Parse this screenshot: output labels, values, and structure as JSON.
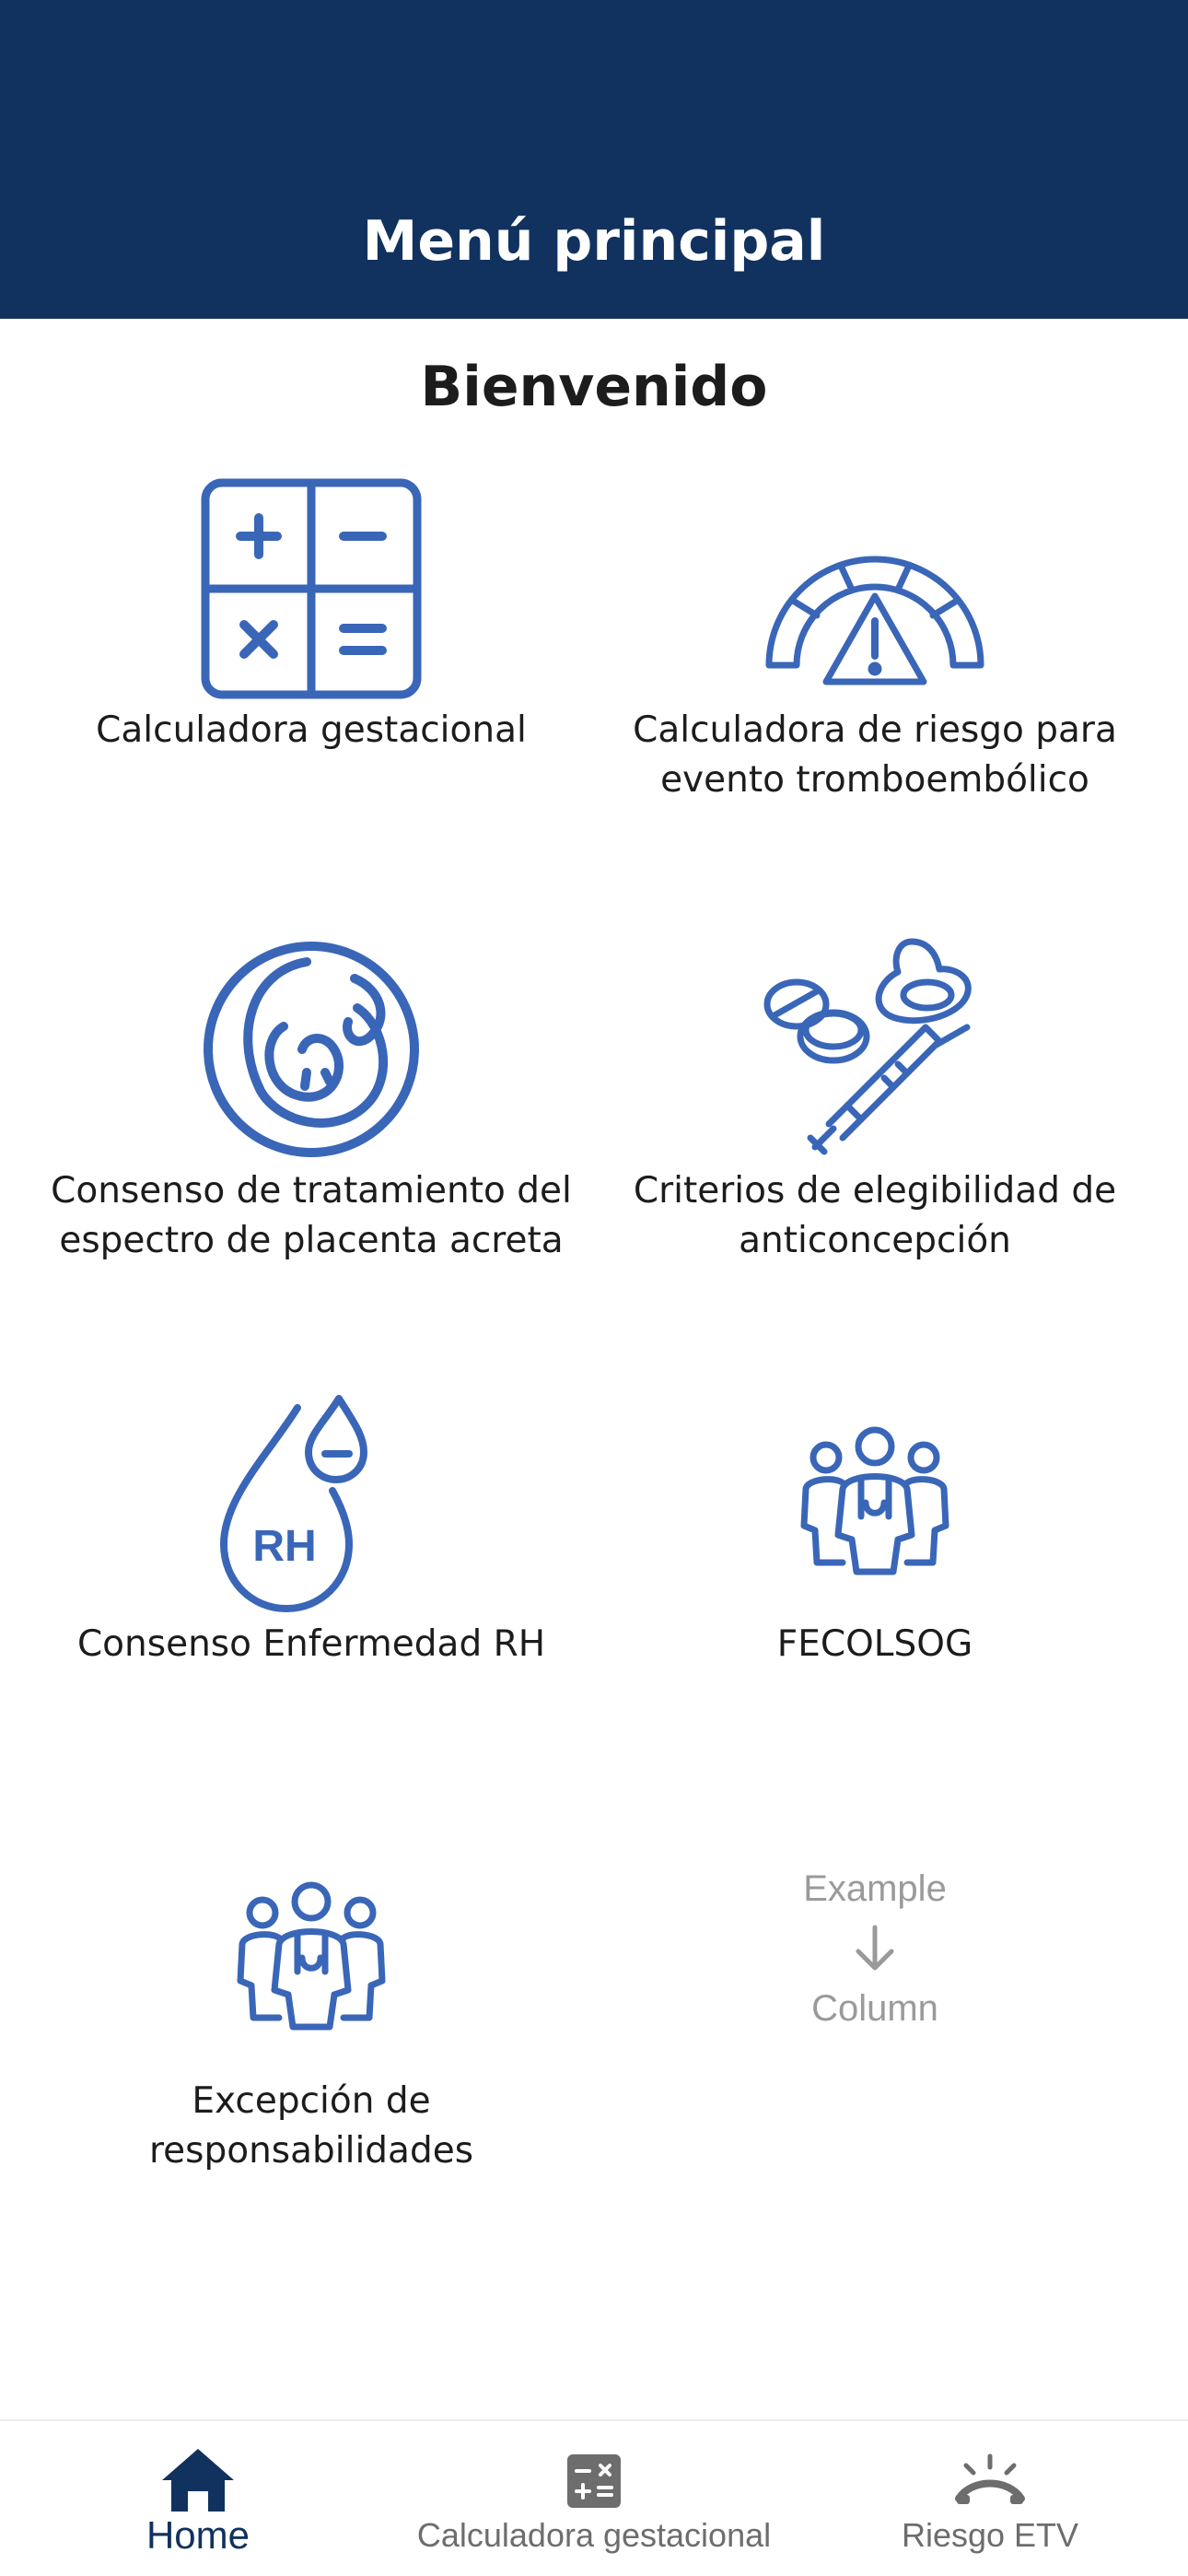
{
  "app_bar": {
    "title": "Menú principal"
  },
  "welcome": "Bienvenido",
  "tiles": [
    {
      "label": "Calculadora gestacional",
      "icon": "calculator-icon"
    },
    {
      "label": "Calculadora  de riesgo para\nevento tromboembólico",
      "icon": "risk-gauge-icon"
    },
    {
      "label": "Consenso de tratamiento del\nespectro de placenta acreta",
      "icon": "fetus-icon"
    },
    {
      "label": "Criterios de elegibilidad de\nanticoncepción",
      "icon": "contraception-icon"
    },
    {
      "label": "Consenso Enfermedad RH",
      "icon": "rh-drop-icon"
    },
    {
      "label": "FECOLSOG",
      "icon": "doctors-group-icon"
    },
    {
      "label": "Excepción de\nresponsabilidades",
      "icon": "doctors-group-icon"
    }
  ],
  "placeholder": {
    "top": "Example",
    "bottom": "Column"
  },
  "bottom_nav": {
    "items": [
      {
        "label": "Home",
        "icon": "home-icon",
        "active": true
      },
      {
        "label": "Calculadora gestacional",
        "icon": "calculator-icon",
        "active": false
      },
      {
        "label": "Riesgo ETV",
        "icon": "risk-gauge-icon",
        "active": false
      }
    ]
  },
  "colors": {
    "primary": "#11325e",
    "icon_blue": "#3a66b8",
    "text": "#1c1c1c",
    "muted": "#9a9a9a",
    "nav_inactive": "#6d6d6d"
  }
}
